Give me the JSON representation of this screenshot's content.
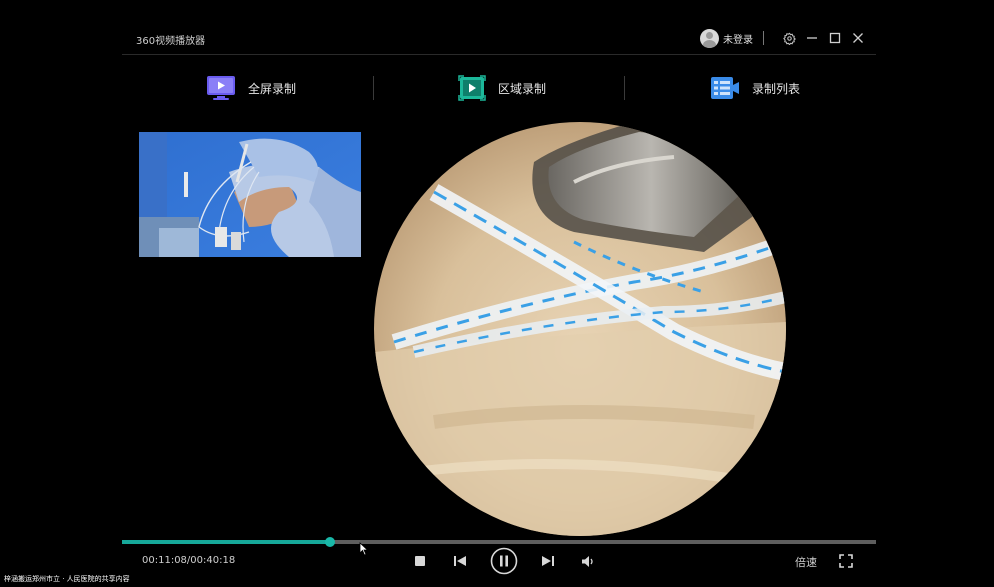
{
  "window": {
    "title": "360视频播放器",
    "user_status": "未登录"
  },
  "record_toolbar": {
    "fullscreen_record": "全屏录制",
    "area_record": "区域录制",
    "record_list": "录制列表"
  },
  "playback": {
    "current_time": "00:11:08",
    "total_time": "00:40:18",
    "time_display": "00:11:08/00:40:18",
    "progress_fraction": 0.2762,
    "speed_label": "倍速",
    "state": "playing"
  },
  "watermark": {
    "text": "梓涵搬运郑州市立 · 人民医院的共享内容"
  },
  "colors": {
    "accent": "#16a89a",
    "background": "#000000",
    "record_icon_fullscreen": "#6a5cf0",
    "record_icon_area": "#1cb89a",
    "record_icon_list": "#3a8be8"
  },
  "icons": {
    "settings": "gear-icon",
    "minimize": "minimize-icon",
    "maximize": "maximize-icon",
    "close": "close-icon",
    "stop": "stop-icon",
    "previous": "previous-icon",
    "pause": "pause-icon",
    "next": "next-icon",
    "volume": "volume-icon",
    "fullscreen": "fullscreen-icon"
  }
}
